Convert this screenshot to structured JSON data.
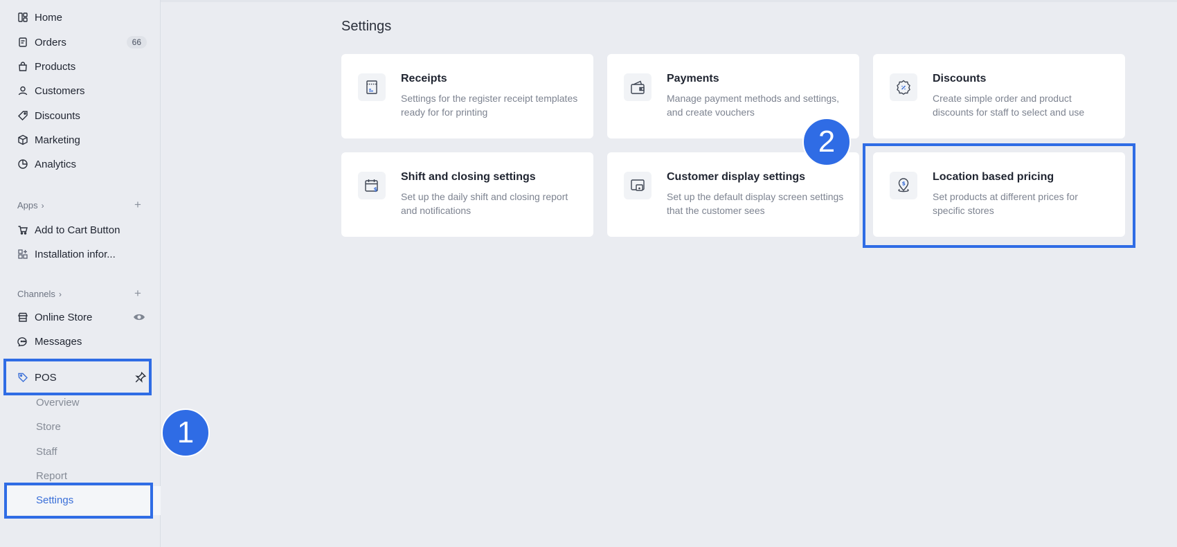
{
  "sidebar": {
    "nav": [
      {
        "label": "Home",
        "icon": "home-icon"
      },
      {
        "label": "Orders",
        "icon": "orders-icon",
        "badge": "66"
      },
      {
        "label": "Products",
        "icon": "products-icon"
      },
      {
        "label": "Customers",
        "icon": "customers-icon"
      },
      {
        "label": "Discounts",
        "icon": "discounts-icon"
      },
      {
        "label": "Marketing",
        "icon": "marketing-icon"
      },
      {
        "label": "Analytics",
        "icon": "analytics-icon"
      }
    ],
    "apps_label": "Apps",
    "apps": [
      {
        "label": "Add to Cart Button",
        "icon": "cart-icon"
      },
      {
        "label": "Installation infor...",
        "icon": "apps-grid-icon"
      }
    ],
    "channels_label": "Channels",
    "channels": [
      {
        "label": "Online Store",
        "icon": "store-icon"
      },
      {
        "label": "Messages",
        "icon": "messages-icon"
      }
    ],
    "pos": {
      "label": "POS",
      "subitems": [
        "Overview",
        "Store",
        "Staff",
        "Report",
        "Settings"
      ],
      "active": "Settings"
    }
  },
  "main": {
    "title": "Settings",
    "cards": [
      {
        "title": "Receipts",
        "desc": "Settings for the register receipt templates ready for for printing",
        "icon": "receipt-icon"
      },
      {
        "title": "Payments",
        "desc": "Manage payment methods and settings, and create vouchers",
        "icon": "wallet-icon"
      },
      {
        "title": "Discounts",
        "desc": "Create simple order and product discounts for staff to select and use",
        "icon": "discount-badge-icon"
      },
      {
        "title": "Shift and closing settings",
        "desc": "Set up the daily shift and closing report and notifications",
        "icon": "calendar-dollar-icon"
      },
      {
        "title": "Customer display settings",
        "desc": "Set up the default display screen settings that the customer sees",
        "icon": "display-icon"
      },
      {
        "title": "Location based pricing",
        "desc": "Set products at different prices for specific stores",
        "icon": "location-dollar-icon"
      }
    ]
  },
  "annotations": {
    "step1": "1",
    "step2": "2"
  },
  "colors": {
    "accent": "#2f6ce5",
    "background": "#eaecf1",
    "active_text": "#3a6fd8"
  }
}
